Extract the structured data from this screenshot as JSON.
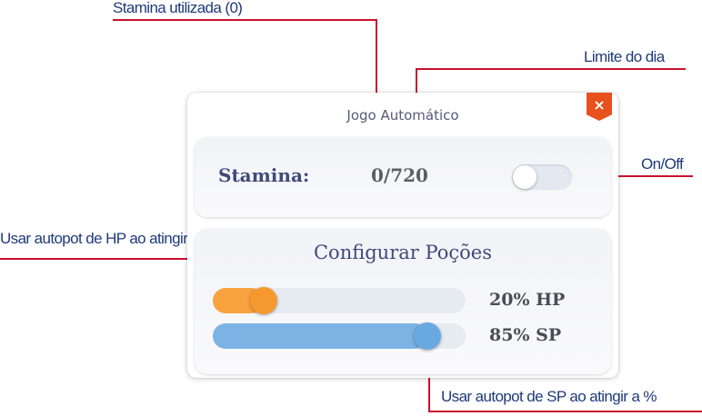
{
  "callouts": {
    "stamina_used": "Stamina utilizada (0)",
    "daily_limit": "Limite do dia",
    "on_off": "On/Off",
    "hp_autopot": "Usar autopot de HP ao atingir a %",
    "sp_autopot": "Usar autopot de SP ao atingir a %"
  },
  "panel": {
    "title": "Jogo Automático",
    "close_label": "×"
  },
  "stamina": {
    "label": "Stamina:",
    "value": "0/720",
    "toggle_on": false
  },
  "potions": {
    "title": "Configurar Poções",
    "hp": {
      "label": "20% HP",
      "percent": 20,
      "color": "#f8a13f"
    },
    "sp": {
      "label": "85% SP",
      "percent": 85,
      "color": "#7ab3e4"
    }
  },
  "colors": {
    "callout_line": "#c8102e",
    "close_button": "#e8501c",
    "heading": "#3e4a7a"
  }
}
